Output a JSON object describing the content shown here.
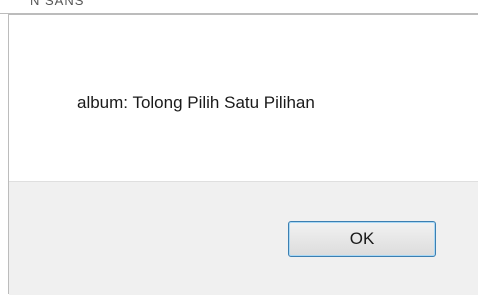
{
  "background_fragment": "N SANS",
  "dialog": {
    "message": "album: Tolong Pilih Satu Pilihan",
    "ok_label": "OK"
  }
}
